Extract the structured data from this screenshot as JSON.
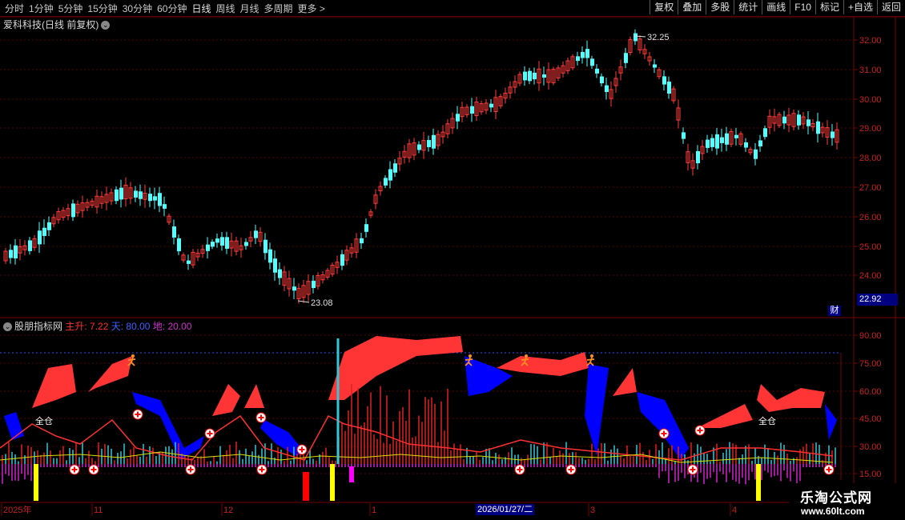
{
  "toolbar": {
    "periods": [
      "分时",
      "1分钟",
      "5分钟",
      "15分钟",
      "30分钟",
      "60分钟",
      "日线",
      "周线",
      "月线",
      "多周期",
      "更多 >"
    ],
    "actions": [
      "复权",
      "叠加",
      "多股",
      "统计",
      "画线",
      "F10",
      "标记",
      "+自选",
      "返回"
    ]
  },
  "stock": {
    "name_line": "爱科科技(日线 前复权)",
    "current_price": "22.92",
    "cai_badge": "财"
  },
  "price_axis": [
    "32.00",
    "31.00",
    "30.00",
    "29.00",
    "28.00",
    "27.00",
    "26.00",
    "25.00",
    "24.00"
  ],
  "annotations": {
    "high": "32.25",
    "low": "23.08"
  },
  "indicator": {
    "name": "股朋指标网",
    "items": [
      {
        "label": "主升: 7.22",
        "color": "#ff3030"
      },
      {
        "label": "天: 80.00",
        "color": "#3050ff"
      },
      {
        "label": "地: 20.00",
        "color": "#d030d0"
      }
    ],
    "axis": [
      "90.00",
      "75.00",
      "60.00",
      "45.00",
      "30.00",
      "15.00"
    ],
    "full_position_label": "全仓"
  },
  "time_axis": [
    "2025年",
    "11",
    "12",
    "1",
    "3",
    "4"
  ],
  "selected_date": "2026/01/27/二",
  "watermark": {
    "line1": "乐淘公式网",
    "line2": "www.60lt.com"
  },
  "colors": {
    "up": "#ff3c3c",
    "down": "#54ffff",
    "bg": "#000000",
    "grid": "#7a0000",
    "blue": "#0000ff",
    "magenta": "#ff00ff"
  }
}
